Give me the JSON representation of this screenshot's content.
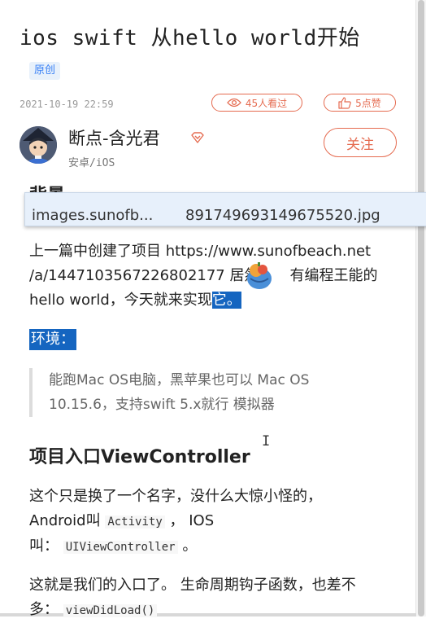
{
  "article": {
    "title": "ios swift 从hello world开始",
    "badge": "原创",
    "date": "2021-10-19 22:59",
    "views": "45人看过",
    "likes": "5点赞"
  },
  "author": {
    "name": "断点-含光君",
    "category": "安卓/iOS",
    "follow_label": "关注"
  },
  "hidden_heading": "背景",
  "tooltip": {
    "left": "images.sunofb...",
    "right": "891749693149675520.jpg"
  },
  "content": {
    "p1_line1": "上一篇中创建了项目 https://www.sunofbeach.net",
    "p1_line2": "/a/1447103567226802177 居然",
    "p1_line2_tail": "有编程王能的",
    "p1_line3": "hello world，今天就来实现",
    "p1_selected": "它。",
    "env_label": "环境：",
    "quote_line1": "能跑Mac OS电脑，黑苹果也可以 Mac OS",
    "quote_line2": "10.15.6，支持swift 5.x就行 模拟器",
    "h2": "项目入口ViewController",
    "p2_a": "这个只是换了一个名字，没什么大惊小怪的，",
    "p2_b": "Android叫",
    "p2_code1": "Activity",
    "p2_c": "， IOS",
    "p2_d": "叫：",
    "p2_code2": "UIViewController",
    "p2_e": "。",
    "p3_a": "这就是我们的入口了。 生命周期钩子函数，也差不",
    "p3_b": "多：",
    "p3_code": "viewDidLoad()"
  },
  "colors": {
    "accent": "#e56b50",
    "badge_blue": "#3b82f6",
    "selection": "#1565c0",
    "tooltip_bg": "#e7f0fb"
  },
  "icons": {
    "views": "eye-icon",
    "likes": "thumbs-up-icon",
    "vip": "diamond-icon",
    "cursor": "text-cursor-icon"
  }
}
